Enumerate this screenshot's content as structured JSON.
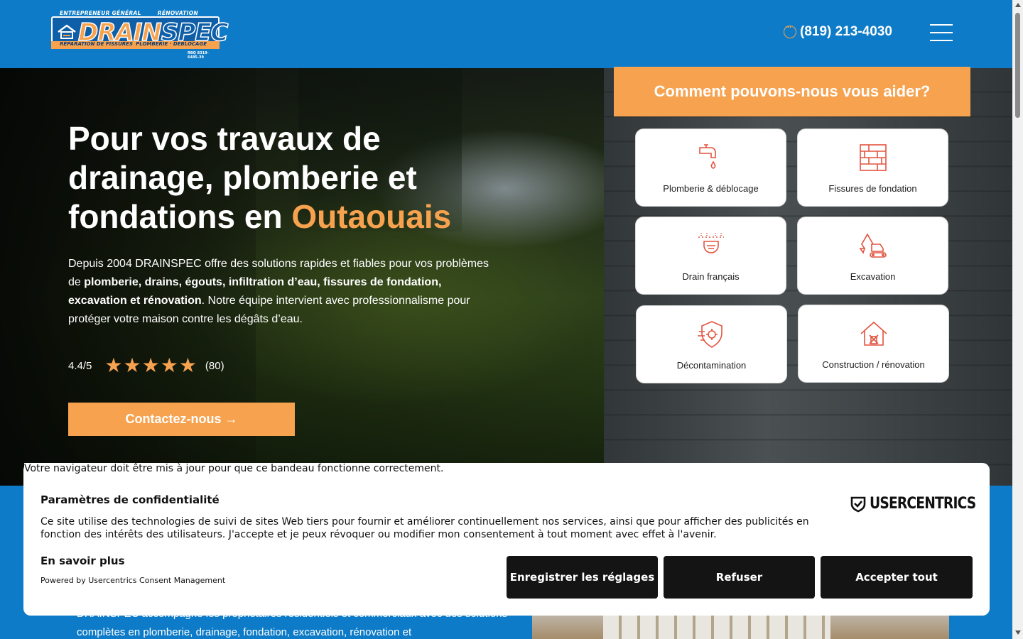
{
  "header": {
    "logo": {
      "top_left": "ENTREPRENEUR GÉNÉRAL",
      "top_right": "RÉNOVATION",
      "word_a": "DRAIN",
      "word_b": "SPEC",
      "bottom_left": "RÉPARATION DE FISSURES",
      "bottom_right": "PLOMBERIE · DÉBLOCAGE",
      "rbq": "RBQ 8319-6485-39"
    },
    "phone": "(819) 213-4030",
    "menu_icon": "hamburger-menu-icon"
  },
  "hero": {
    "title_line": "Pour vos travaux de drainage, plomberie et fondations en",
    "title_accent": "Outaouais",
    "intro_1": "Depuis 2004 DRAINSPEC offre des solutions rapides et fiables pour vos problèmes de ",
    "intro_bold": "plomberie, drains, égouts, infiltration d’eau, fissures de fondation, excavation et rénovation",
    "intro_2": ". Notre équipe intervient avec professionnalisme pour protéger votre maison contre les dégâts d’eau.",
    "rating_score": "4.4/5",
    "rating_count": "(80)",
    "rating_stars": 5,
    "cta_label": "Contactez-nous →"
  },
  "help": {
    "title": "Comment pouvons-nous vous aider?",
    "services": [
      {
        "label": "Plomberie & déblocage",
        "icon": "faucet-icon"
      },
      {
        "label": "Fissures de fondation",
        "icon": "brick-wall-icon"
      },
      {
        "label": "Drain français",
        "icon": "drain-icon"
      },
      {
        "label": "Excavation",
        "icon": "excavator-icon"
      },
      {
        "label": "Décontamination",
        "icon": "shield-virus-icon"
      },
      {
        "label": "Construction / rénovation",
        "icon": "house-tools-icon"
      }
    ]
  },
  "below": {
    "text": "DRAINSPEC accompagne les propriétaires résidentiels et commerciaux avec des solutions complètes en plomberie, drainage, fondation, excavation, rénovation et"
  },
  "consent": {
    "browser_warning": "Votre navigateur doit être mis à jour pour que ce bandeau fonctionne correctement.",
    "title": "Paramètres de confidentialité",
    "body": "Ce site utilise des technologies de suivi de sites Web tiers pour fournir et améliorer continuellement nos services, ainsi que pour afficher des publicités en fonction des intérêts des utilisateurs. J'accepte et je peux révoquer ou modifier mon consentement à tout moment avec effet à l'avenir.",
    "more": "En savoir plus",
    "powered": "Powered by Usercentrics Consent Management",
    "brand": "USERCENTRICS",
    "btn_settings": "Enregistrer les réglages",
    "btn_refuse": "Refuser",
    "btn_accept": "Accepter tout"
  },
  "colors": {
    "brand_blue": "#0d7bc7",
    "accent_orange": "#f7a24f",
    "icon_red": "#e2533f"
  }
}
